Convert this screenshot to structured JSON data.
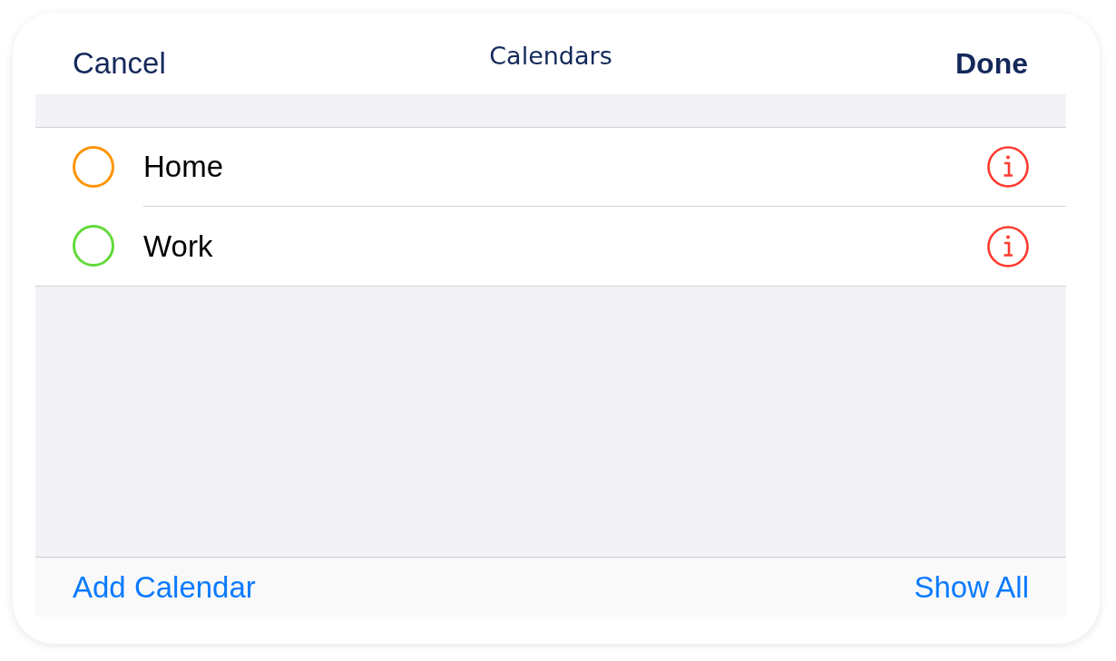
{
  "header": {
    "cancel": "Cancel",
    "title": "Calendars",
    "done": "Done"
  },
  "calendars": [
    {
      "name": "Home",
      "color": "#ff9500",
      "checked": false
    },
    {
      "name": "Work",
      "color": "#63da38",
      "checked": false
    }
  ],
  "toolbar": {
    "add": "Add Calendar",
    "show_all": "Show All"
  }
}
